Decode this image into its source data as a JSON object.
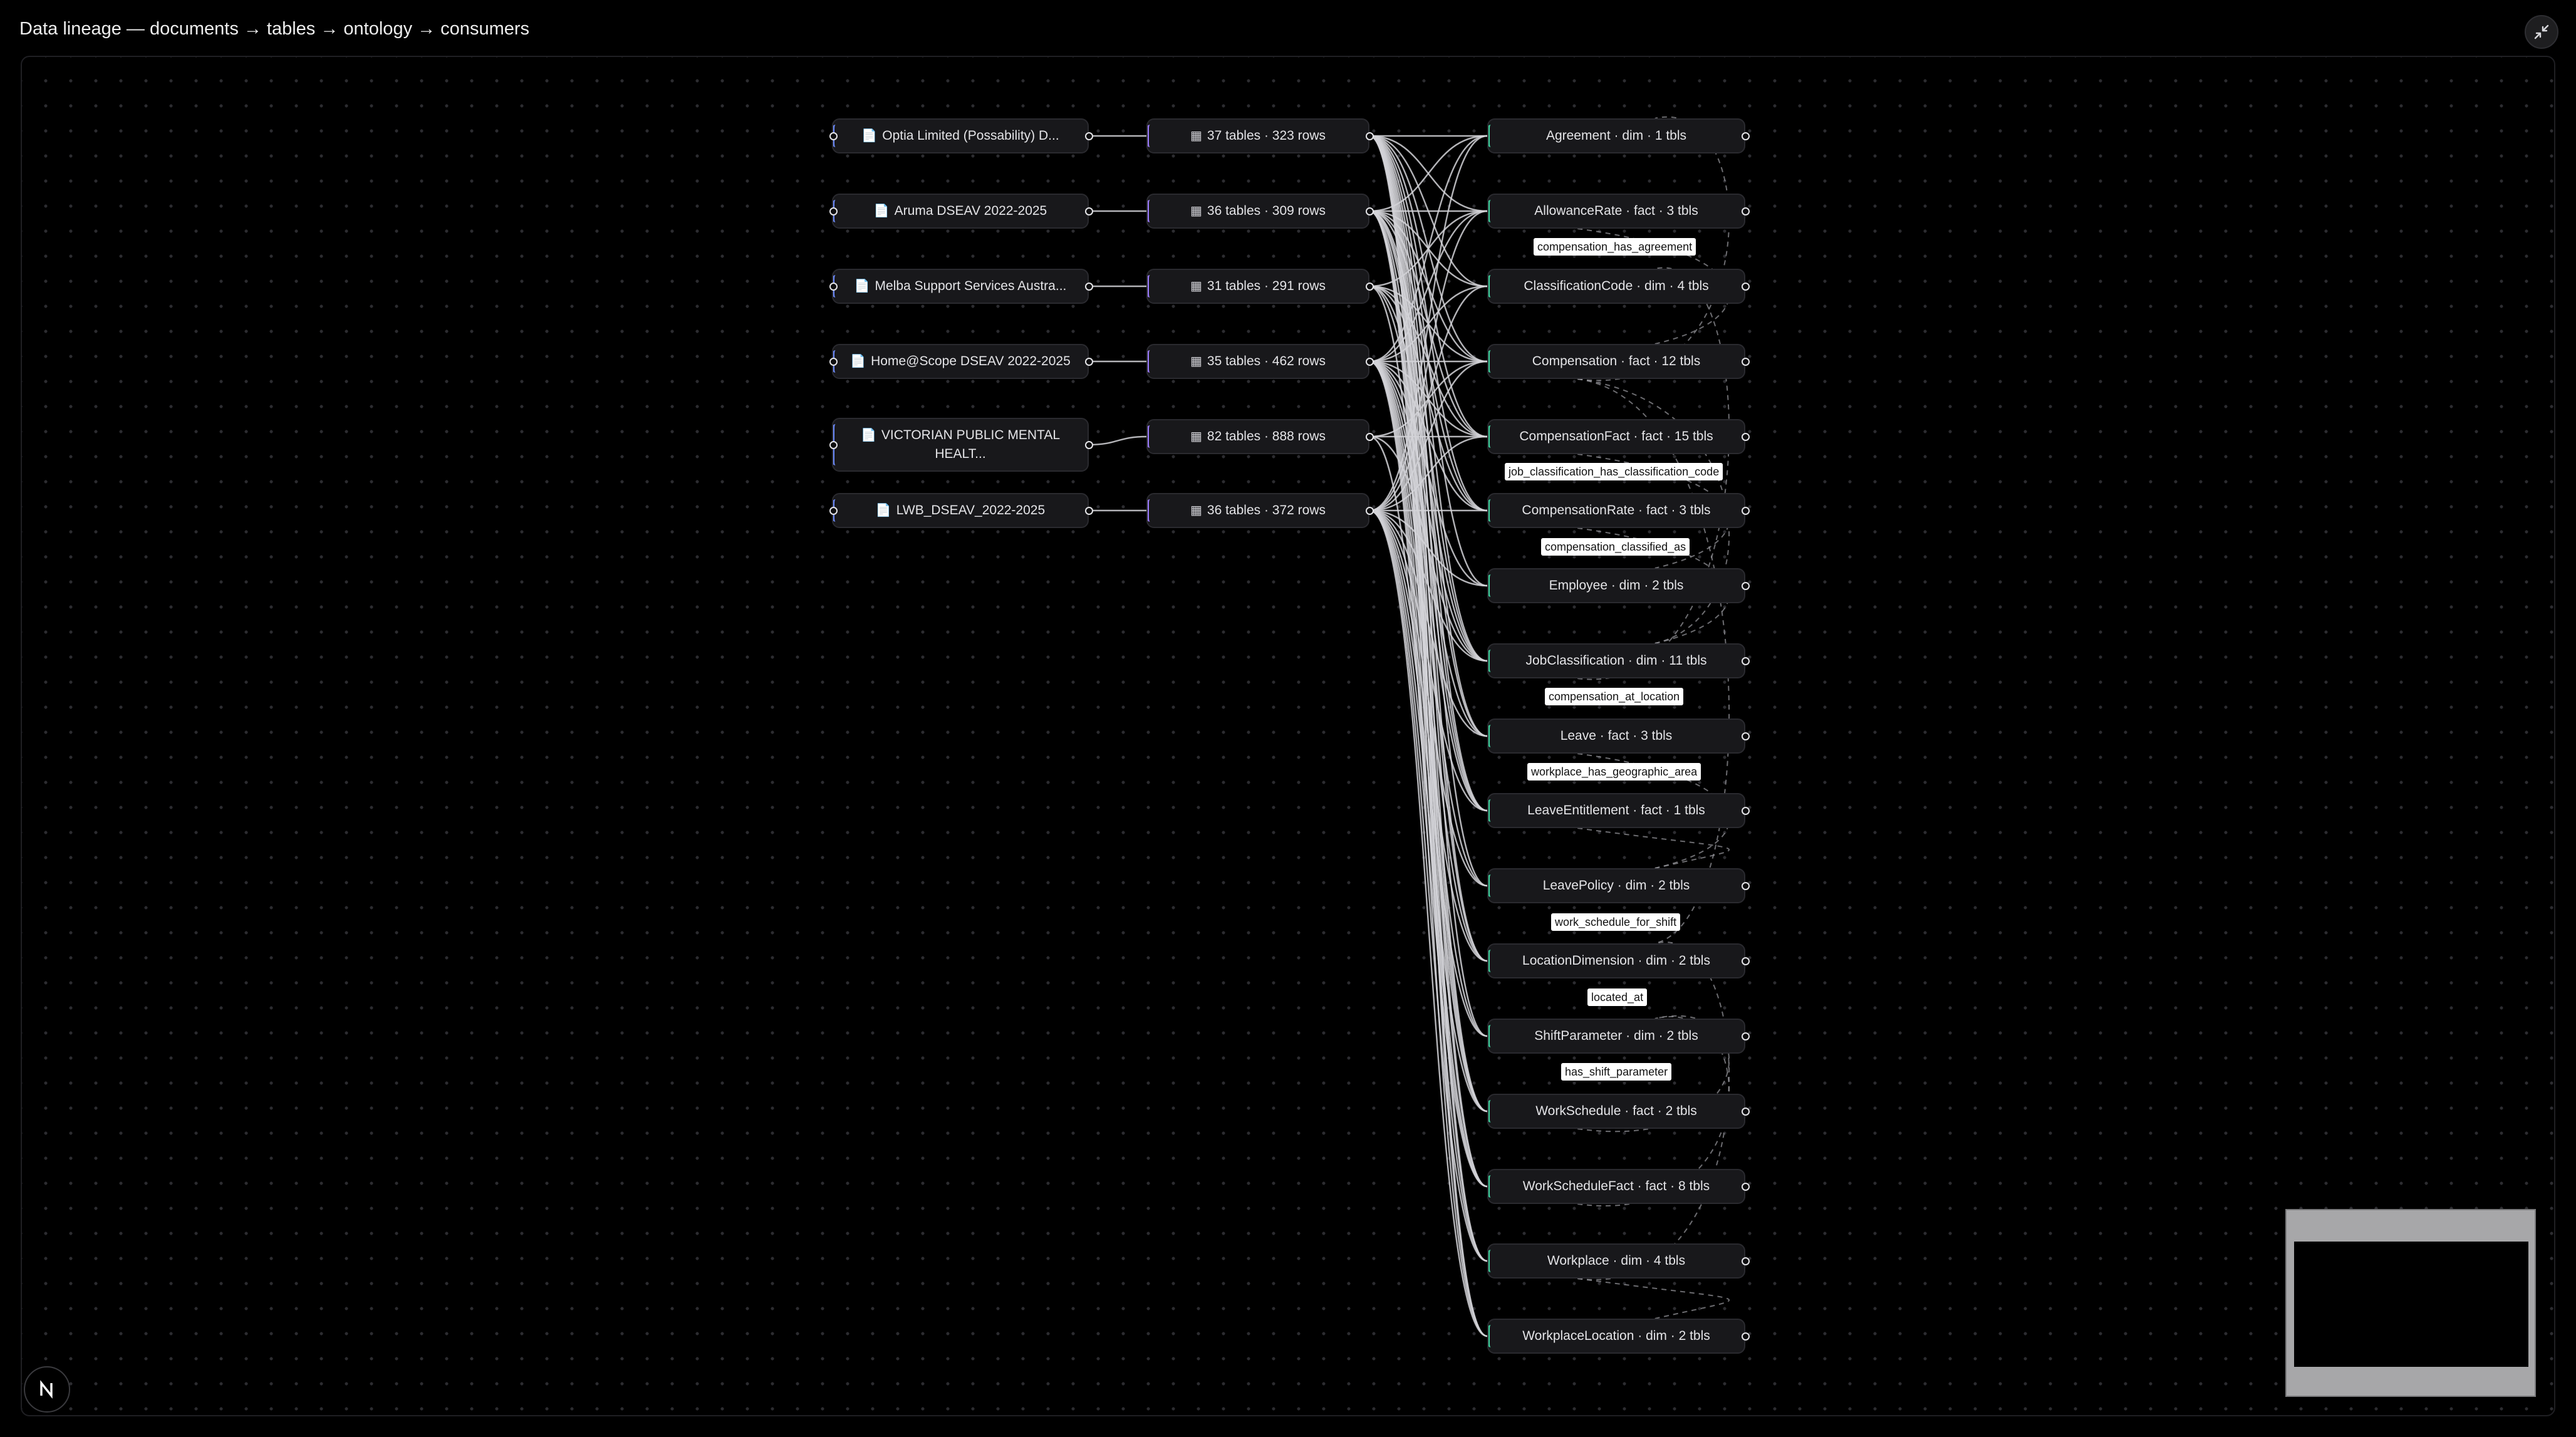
{
  "header": {
    "title": "Data lineage — documents → tables → ontology → consumers"
  },
  "icons": {
    "document": "📄",
    "table": "▦"
  },
  "documents": [
    {
      "label": "Optia Limited (Possability) D..."
    },
    {
      "label": "Aruma DSEAV 2022-2025"
    },
    {
      "label": "Melba Support Services Austra..."
    },
    {
      "label": "Home@Scope DSEAV 2022-2025"
    },
    {
      "label": "VICTORIAN PUBLIC MENTAL HEALT..."
    },
    {
      "label": "LWB_DSEAV_2022-2025"
    }
  ],
  "tables": [
    {
      "label": "37 tables · 323 rows"
    },
    {
      "label": "36 tables · 309 rows"
    },
    {
      "label": "31 tables · 291 rows"
    },
    {
      "label": "35 tables · 462 rows"
    },
    {
      "label": "82 tables · 888 rows"
    },
    {
      "label": "36 tables · 372 rows"
    }
  ],
  "ontology": [
    {
      "label": "Agreement · dim · 1 tbls"
    },
    {
      "label": "AllowanceRate · fact · 3 tbls"
    },
    {
      "label": "ClassificationCode · dim · 4 tbls"
    },
    {
      "label": "Compensation · fact · 12 tbls"
    },
    {
      "label": "CompensationFact · fact · 15 tbls"
    },
    {
      "label": "CompensationRate · fact · 3 tbls"
    },
    {
      "label": "Employee · dim · 2 tbls"
    },
    {
      "label": "JobClassification · dim · 11 tbls"
    },
    {
      "label": "Leave · fact · 3 tbls"
    },
    {
      "label": "LeaveEntitlement · fact · 1 tbls"
    },
    {
      "label": "LeavePolicy · dim · 2 tbls"
    },
    {
      "label": "LocationDimension · dim · 2 tbls"
    },
    {
      "label": "ShiftParameter · dim · 2 tbls"
    },
    {
      "label": "WorkSchedule · fact · 2 tbls"
    },
    {
      "label": "WorkScheduleFact · fact · 8 tbls"
    },
    {
      "label": "Workplace · dim · 4 tbls"
    },
    {
      "label": "WorkplaceLocation · dim · 2 tbls"
    }
  ],
  "relationships": [
    {
      "label": "compensation_has_agreement"
    },
    {
      "label": "job_classification_has_classification_code"
    },
    {
      "label": "compensation_classified_as"
    },
    {
      "label": "compensation_at_location"
    },
    {
      "label": "workplace_has_geographic_area"
    },
    {
      "label": "work_schedule_for_shift"
    },
    {
      "label": "located_at"
    },
    {
      "label": "has_shift_parameter"
    }
  ],
  "colors": {
    "document_accent": "#6d8cff",
    "table_accent": "#9b7bff",
    "ontology_accent": "#3ed6a0",
    "edge": "#d4d4d8"
  }
}
